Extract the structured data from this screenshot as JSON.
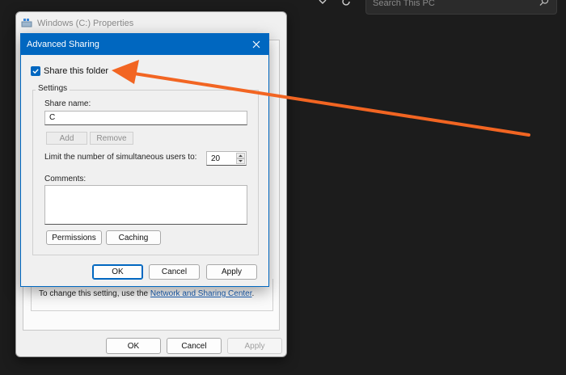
{
  "background": {
    "search_placeholder": "Search This PC"
  },
  "properties_window": {
    "title": "Windows (C:) Properties",
    "note_text": "To change this setting, use the ",
    "note_link": "Network and Sharing Center",
    "note_end": ".",
    "buttons": {
      "ok": "OK",
      "cancel": "Cancel",
      "apply": "Apply"
    }
  },
  "advanced_sharing": {
    "title": "Advanced Sharing",
    "share_checkbox": {
      "label": "Share this folder",
      "checked": true
    },
    "settings_legend": "Settings",
    "share_name_label": "Share name:",
    "share_name_value": "C",
    "add_button": "Add",
    "remove_button": "Remove",
    "limit_label": "Limit the number of simultaneous users to:",
    "limit_value": "20",
    "comments_label": "Comments:",
    "comments_value": "",
    "permissions_button": "Permissions",
    "caching_button": "Caching",
    "buttons": {
      "ok": "OK",
      "cancel": "Cancel",
      "apply": "Apply"
    }
  },
  "colors": {
    "accent": "#0067c0",
    "annotation_arrow": "#f26522"
  }
}
